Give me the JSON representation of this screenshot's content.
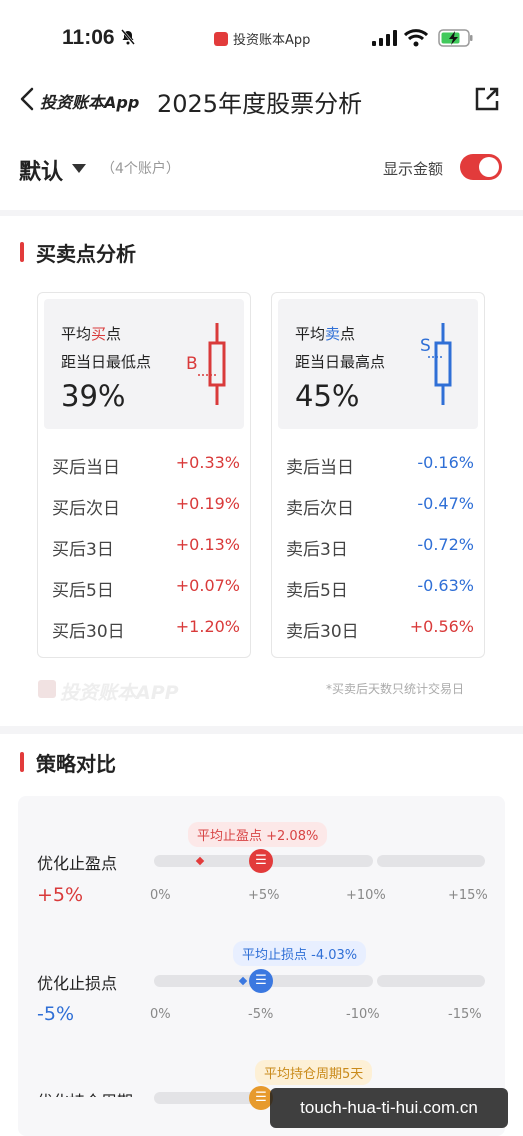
{
  "status_bar": {
    "time": "11:06",
    "app_chip": "投资账本App",
    "icons": [
      "bell-muted-icon",
      "signal-icon",
      "wifi-icon",
      "battery-charging-icon"
    ]
  },
  "nav": {
    "back_label": "投资账本App",
    "title": "2025年度股票分析",
    "share_icon": "share-icon"
  },
  "account": {
    "name": "默认",
    "count": "（4个账户）",
    "show_amount_label": "显示金额",
    "show_amount_on": true
  },
  "buy_sell": {
    "title": "买卖点分析",
    "buy_card": {
      "line1_prefix": "平均",
      "line1_highlight": "买",
      "line1_suffix": "点",
      "line2": "距当日最低点",
      "percent": "39%",
      "marker": "B",
      "rows": [
        {
          "label": "买后当日",
          "value": "+0.33%",
          "sign": "pos"
        },
        {
          "label": "买后次日",
          "value": "+0.19%",
          "sign": "pos"
        },
        {
          "label": "买后3日",
          "value": "+0.13%",
          "sign": "pos"
        },
        {
          "label": "买后5日",
          "value": "+0.07%",
          "sign": "pos"
        },
        {
          "label": "买后30日",
          "value": "+1.20%",
          "sign": "pos"
        }
      ]
    },
    "sell_card": {
      "line1_prefix": "平均",
      "line1_highlight": "卖",
      "line1_suffix": "点",
      "line2": "距当日最高点",
      "percent": "45%",
      "marker": "S",
      "rows": [
        {
          "label": "卖后当日",
          "value": "-0.16%",
          "sign": "neg"
        },
        {
          "label": "卖后次日",
          "value": "-0.47%",
          "sign": "neg"
        },
        {
          "label": "卖后3日",
          "value": "-0.72%",
          "sign": "neg"
        },
        {
          "label": "卖后5日",
          "value": "-0.63%",
          "sign": "neg"
        },
        {
          "label": "卖后30日",
          "value": "+0.56%",
          "sign": "pos"
        }
      ]
    },
    "watermark": "投资账本APP",
    "footnote": "*买卖后天数只统计交易日"
  },
  "strategy": {
    "title": "策略对比",
    "items": [
      {
        "label": "优化止盈点",
        "value": "+5%",
        "bubble": "平均止盈点 +2.08%",
        "ticks": [
          "0%",
          "+5%",
          "+10%",
          "+15%"
        ],
        "thumb_fraction": 0.333,
        "marker_fraction": 0.139
      },
      {
        "label": "优化止损点",
        "value": "-5%",
        "bubble": "平均止损点 -4.03%",
        "ticks": [
          "0%",
          "-5%",
          "-10%",
          "-15%"
        ],
        "thumb_fraction": 0.333,
        "marker_fraction": 0.269
      },
      {
        "label": "优化持仓周期",
        "bubble": "平均持仓周期5天"
      }
    ]
  },
  "overlay": "touch-hua-ti-hui.com.cn",
  "colors": {
    "red": "#e23b3b",
    "blue": "#2f6fd6",
    "orange": "#e79a2c"
  }
}
